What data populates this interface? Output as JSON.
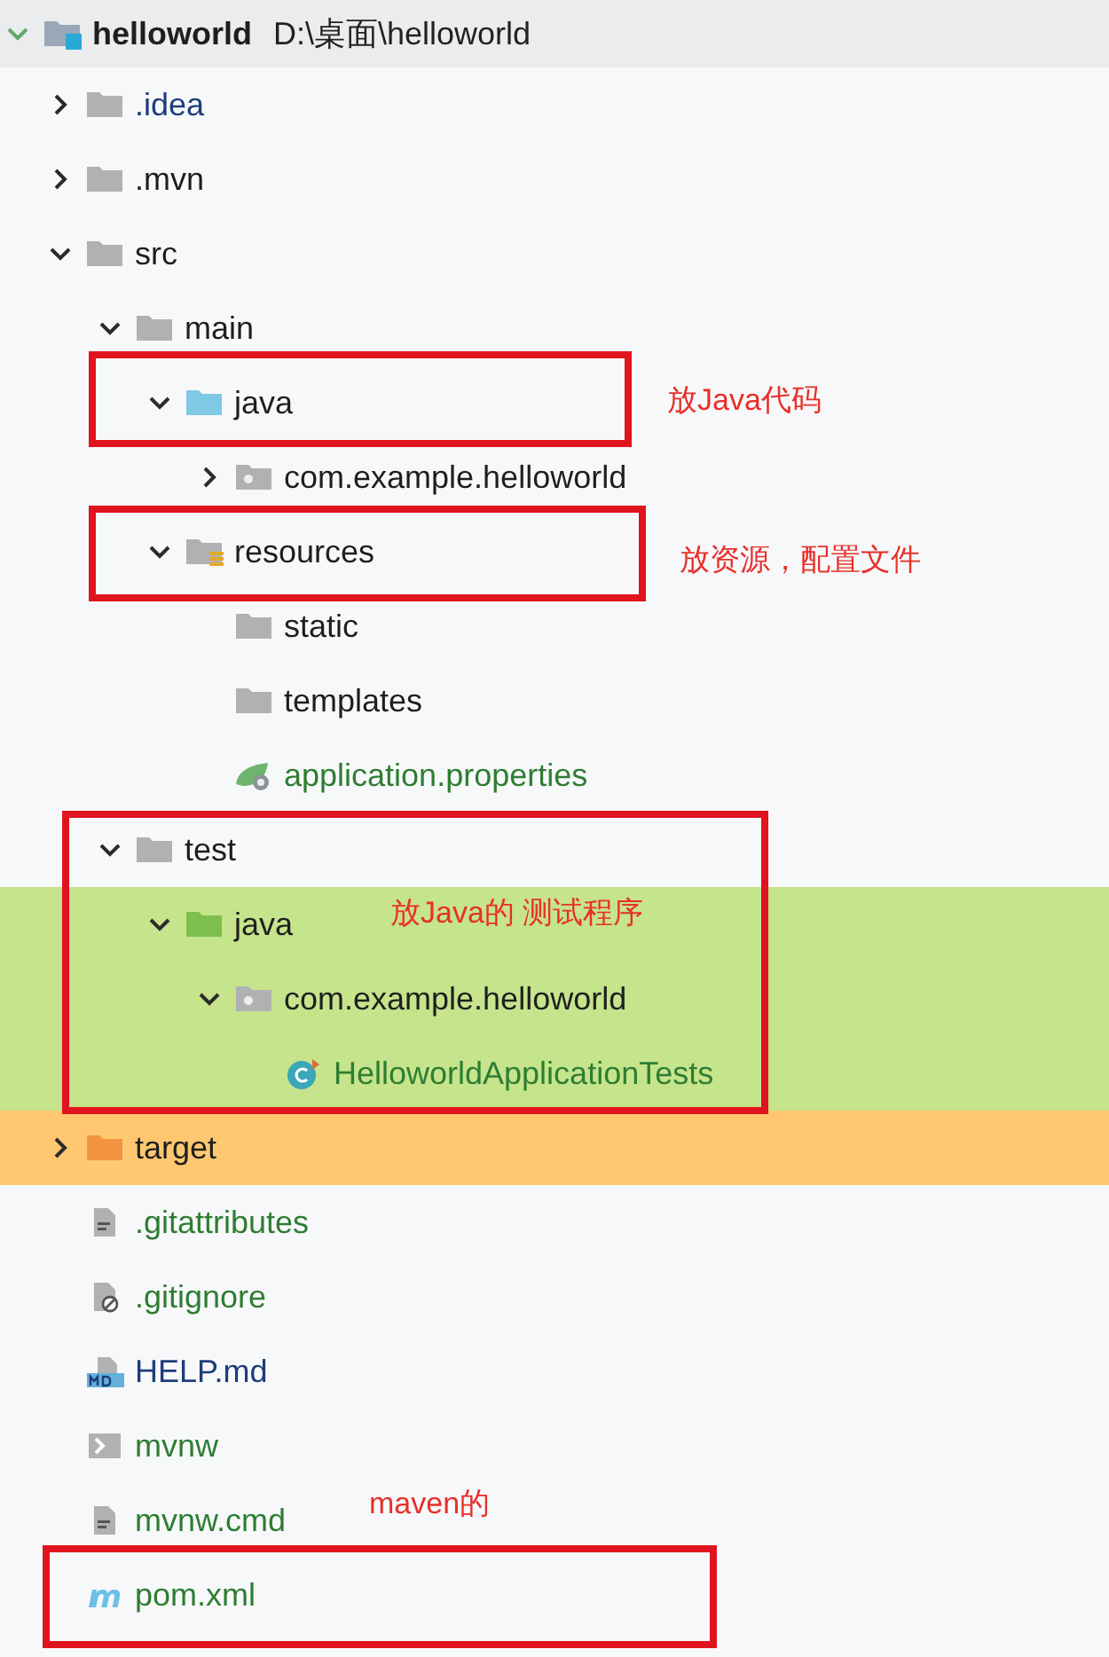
{
  "project": {
    "name": "helloworld",
    "path": "D:\\桌面\\helloworld",
    "expanded": true
  },
  "tree": [
    {
      "label": ".idea",
      "kind": "folder",
      "git_added": false,
      "git_modified": true,
      "expanded": false
    },
    {
      "label": ".mvn",
      "kind": "folder",
      "git_added": false,
      "git_modified": false,
      "expanded": false
    },
    {
      "label": "src",
      "kind": "folder",
      "git_added": false,
      "git_modified": false,
      "expanded": true,
      "children": [
        {
          "label": "main",
          "kind": "folder",
          "git_added": false,
          "git_modified": false,
          "expanded": true,
          "children": [
            {
              "label": "java",
              "kind": "source-folder",
              "git_added": false,
              "git_modified": false,
              "expanded": true,
              "note": "放Java代码",
              "children": [
                {
                  "label": "com.example.helloworld",
                  "kind": "package",
                  "git_added": false,
                  "git_modified": false,
                  "expanded": false
                }
              ]
            },
            {
              "label": "resources",
              "kind": "resources-folder",
              "git_added": false,
              "git_modified": false,
              "expanded": true,
              "note": "放资源，配置文件",
              "children": [
                {
                  "label": "static",
                  "kind": "folder",
                  "git_added": false,
                  "git_modified": false
                },
                {
                  "label": "templates",
                  "kind": "folder",
                  "git_added": false,
                  "git_modified": false
                },
                {
                  "label": "application.properties",
                  "kind": "spring-properties",
                  "git_added": true,
                  "git_modified": false
                }
              ]
            }
          ]
        },
        {
          "label": "test",
          "kind": "folder",
          "git_added": false,
          "git_modified": false,
          "expanded": true,
          "children": [
            {
              "label": "java",
              "kind": "test-folder",
              "git_added": false,
              "git_modified": false,
              "expanded": true,
              "color": "#c5e48b",
              "note": "放Java的 测试程序",
              "children": [
                {
                  "label": "com.example.helloworld",
                  "kind": "package",
                  "git_added": false,
                  "git_modified": false,
                  "expanded": true,
                  "color": "#c5e48b",
                  "children": [
                    {
                      "label": "HelloworldApplicationTests",
                      "kind": "test-class",
                      "git_added": true,
                      "git_modified": false,
                      "color": "#c5e48b"
                    }
                  ]
                }
              ]
            }
          ]
        }
      ]
    },
    {
      "label": "target",
      "kind": "excluded-folder",
      "git_added": false,
      "git_modified": false,
      "expanded": false,
      "color": "#ffc870"
    },
    {
      "label": ".gitattributes",
      "kind": "text-file",
      "git_added": true,
      "git_modified": false
    },
    {
      "label": ".gitignore",
      "kind": "ignore-file",
      "git_added": true,
      "git_modified": false
    },
    {
      "label": "HELP.md",
      "kind": "markdown-file",
      "git_added": false,
      "git_modified": true
    },
    {
      "label": "mvnw",
      "kind": "shell-file",
      "git_added": true,
      "git_modified": false
    },
    {
      "label": "mvnw.cmd",
      "kind": "text-file",
      "git_added": true,
      "git_modified": false,
      "note": "maven的"
    },
    {
      "label": "pom.xml",
      "kind": "maven-file",
      "git_added": true,
      "git_modified": false
    }
  ]
}
